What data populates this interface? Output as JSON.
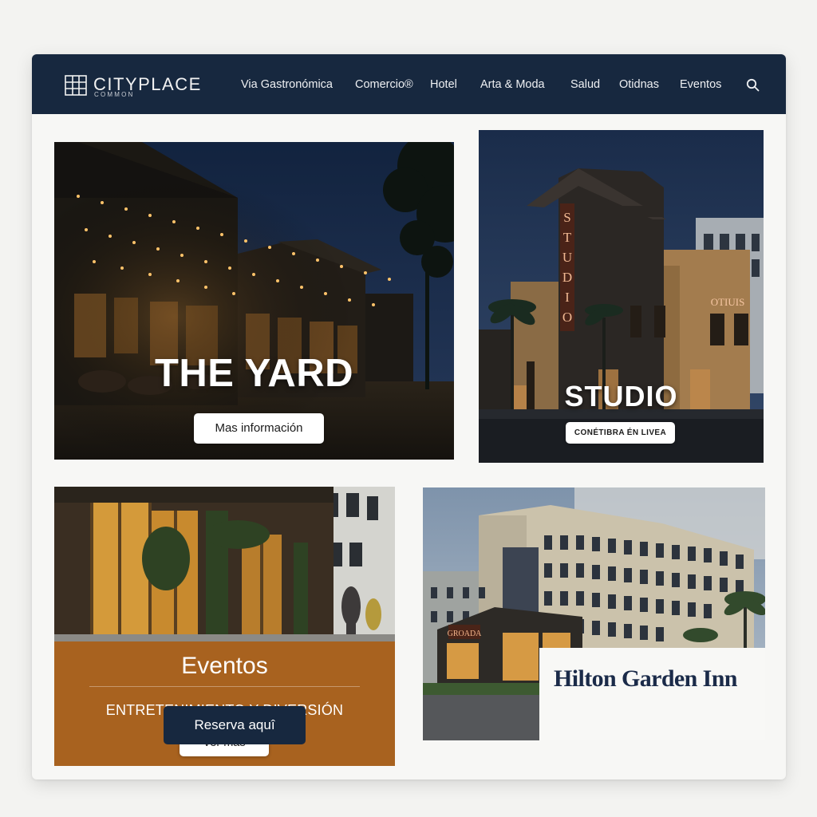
{
  "brand": {
    "name": "CITYPLACE",
    "tagline": "COMMON"
  },
  "nav": {
    "items": [
      "Via Gastronómica",
      "Comercio®",
      "Hotel",
      "Arta & Moda",
      "Salud",
      "Otidnas",
      "Eventos"
    ],
    "search_icon": "search-icon"
  },
  "cards": {
    "yard": {
      "title": "THE YARD",
      "button": "Mas información"
    },
    "studio": {
      "title": "STUDIO",
      "button": "CONÉTIBRA ÉN LIVEA",
      "sign_vertical": "STUDIO",
      "sign_side": "OTIUIS"
    },
    "eventos": {
      "title": "Eventos",
      "subtitle": "ENTRETENIMIENTO Y DIVERSIÓN",
      "button": "Ver más"
    },
    "hilton": {
      "name": "Hilton Garden Inn",
      "button": "Reserva aquî",
      "sign": "GROADA"
    }
  },
  "colors": {
    "navy": "#17283f",
    "amber": "#a8621f",
    "page_bg": "#f3f3f1"
  }
}
